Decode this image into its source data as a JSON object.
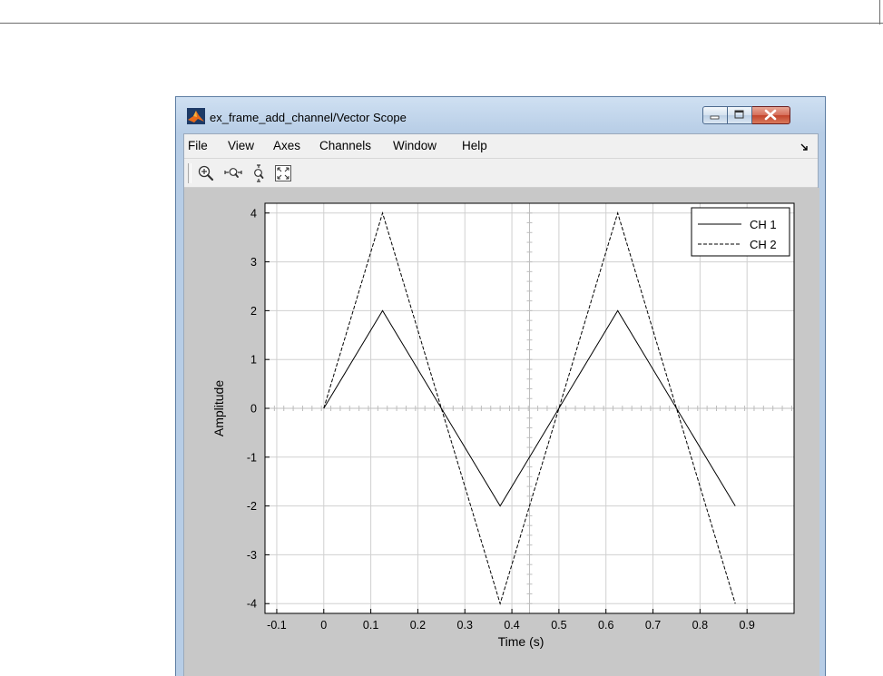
{
  "window": {
    "title": "ex_frame_add_channel/Vector Scope",
    "icons": {
      "logo": "matlab-logo-icon",
      "minimize": "minimize-icon",
      "maximize": "maximize-icon",
      "close": "close-icon"
    }
  },
  "menu": {
    "items": [
      "File",
      "View",
      "Axes",
      "Channels",
      "Window",
      "Help"
    ],
    "dock_icon": "dock-arrow-icon"
  },
  "toolbar": {
    "tools": [
      "zoom-in-icon",
      "zoom-x-icon",
      "zoom-y-icon",
      "autoscale-icon"
    ]
  },
  "colors": {
    "plot_background": "#ffffff",
    "figure_background": "#c8c8c8",
    "grid": "#d0d0d0",
    "series": "#000000",
    "close_button": "#c2442c"
  },
  "chart_data": {
    "type": "line",
    "xlabel": "Time (s)",
    "ylabel": "Amplitude",
    "xlim": [
      -0.125,
      1.0
    ],
    "ylim": [
      -4.2,
      4.2
    ],
    "xticks": [
      -0.1,
      0,
      0.1,
      0.2,
      0.3,
      0.4,
      0.5,
      0.6,
      0.7,
      0.8,
      0.9
    ],
    "xtick_labels": [
      "-0.1",
      "0",
      "0.1",
      "0.2",
      "0.3",
      "0.4",
      "0.5",
      "0.6",
      "0.7",
      "0.8",
      "0.9"
    ],
    "yticks": [
      4,
      3,
      2,
      1,
      0,
      -1,
      -2,
      -3,
      -4
    ],
    "ytick_labels": [
      "4",
      "3",
      "2",
      "1",
      "0",
      "-1",
      "-2",
      "-3",
      "-4"
    ],
    "grid": true,
    "legend_position": "top-right",
    "series": [
      {
        "name": "CH 1",
        "style": "solid",
        "x": [
          0,
          0.125,
          0.375,
          0.625,
          0.875
        ],
        "y": [
          0,
          2,
          -2,
          2,
          -2
        ]
      },
      {
        "name": "CH 2",
        "style": "dashed",
        "x": [
          0,
          0.125,
          0.375,
          0.625,
          0.875
        ],
        "y": [
          0,
          4,
          -4,
          4,
          -4
        ]
      }
    ]
  }
}
